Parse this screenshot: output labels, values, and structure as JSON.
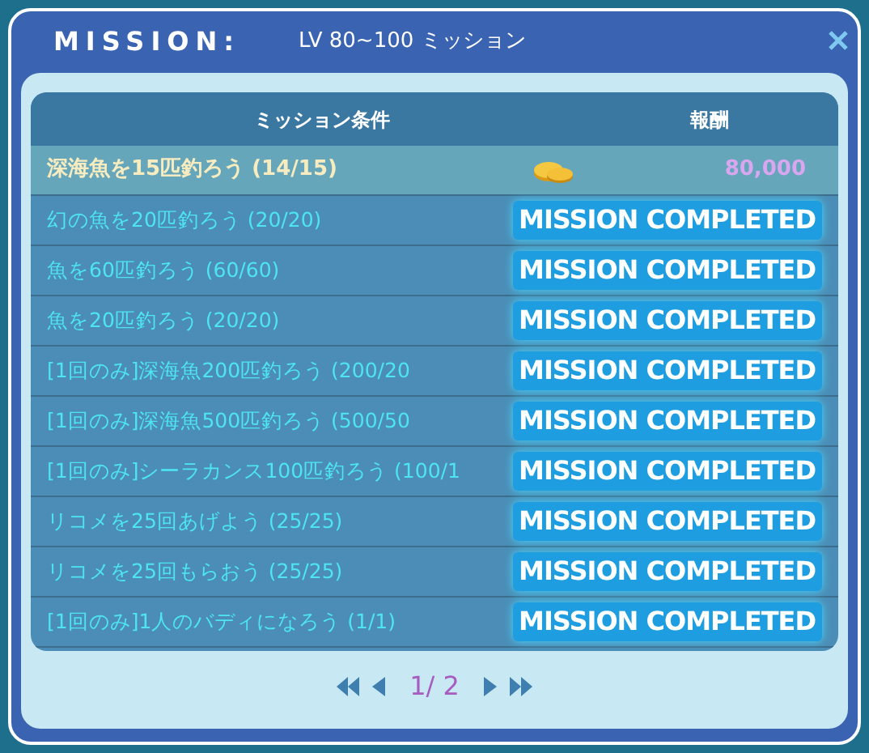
{
  "window": {
    "title": "MISSION:",
    "subtitle": "LV 80~100 ミッション"
  },
  "table": {
    "columns": [
      "ミッション条件",
      "報酬"
    ],
    "rows": [
      {
        "kind": "reward",
        "condition": "深海魚を15匹釣ろう (14/15)",
        "reward": "80,000"
      },
      {
        "kind": "completed",
        "condition": "幻の魚を20匹釣ろう (20/20)",
        "status": "MISSION COMPLETED"
      },
      {
        "kind": "completed",
        "condition": "魚を60匹釣ろう (60/60)",
        "status": "MISSION COMPLETED"
      },
      {
        "kind": "completed",
        "condition": "魚を20匹釣ろう (20/20)",
        "status": "MISSION COMPLETED"
      },
      {
        "kind": "completed",
        "condition": "[1回のみ]深海魚200匹釣ろう (200/20",
        "status": "MISSION COMPLETED"
      },
      {
        "kind": "completed",
        "condition": "[1回のみ]深海魚500匹釣ろう (500/50",
        "status": "MISSION COMPLETED"
      },
      {
        "kind": "completed",
        "condition": "[1回のみ]シーラカンス100匹釣ろう (100/1",
        "status": "MISSION COMPLETED"
      },
      {
        "kind": "completed",
        "condition": "リコメを25回あげよう (25/25)",
        "status": "MISSION COMPLETED"
      },
      {
        "kind": "completed",
        "condition": "リコメを25回もらおう (25/25)",
        "status": "MISSION COMPLETED"
      },
      {
        "kind": "completed",
        "condition": "[1回のみ]1人のバディになろう (1/1)",
        "status": "MISSION COMPLETED"
      }
    ]
  },
  "pagination": {
    "page": "1/ 2"
  }
}
